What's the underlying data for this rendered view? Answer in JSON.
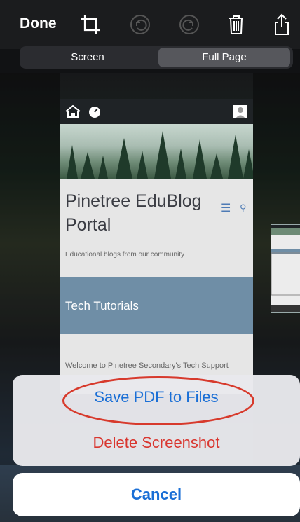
{
  "topbar": {
    "done_label": "Done",
    "icons": [
      "crop-icon",
      "undo-icon",
      "redo-icon",
      "trash-icon",
      "share-icon"
    ]
  },
  "segmented": {
    "options": [
      "Screen",
      "Full Page"
    ],
    "selected": "Full Page"
  },
  "preview": {
    "site_title": "Pinetree EduBlog Portal",
    "tagline": "Educational blogs from our community",
    "section_title": "Tech Tutorials",
    "welcome_text": "Welcome to Pinetree Secondary's Tech Support"
  },
  "action_sheet": {
    "save_label": "Save PDF to Files",
    "delete_label": "Delete Screenshot",
    "cancel_label": "Cancel"
  },
  "colors": {
    "accent_blue": "#1a6fd6",
    "destructive_red": "#d9362f",
    "highlight_circle": "#d73a2c"
  }
}
